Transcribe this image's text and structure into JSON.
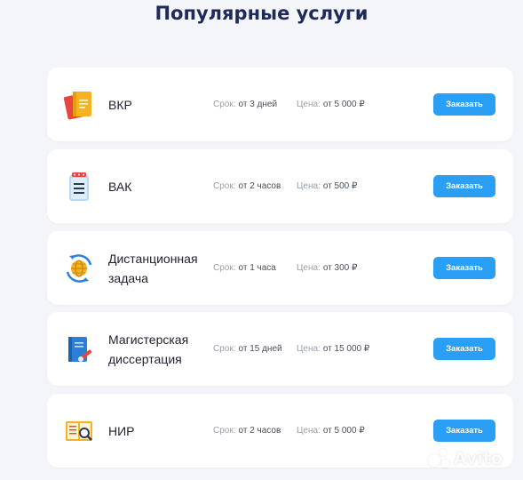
{
  "page": {
    "title": "Популярные услуги"
  },
  "services": [
    {
      "name": "ВКР",
      "term_label": "Срок:",
      "term_value": "от 3 дней",
      "price_label": "Цена:",
      "price_value": "от 5 000 ₽",
      "button": "Заказать",
      "icon": "notebook-icon"
    },
    {
      "name": "ВАК",
      "term_label": "Срок:",
      "term_value": "от 2 часов",
      "price_label": "Цена:",
      "price_value": "от 500 ₽",
      "button": "Заказать",
      "icon": "notepad-icon"
    },
    {
      "name": "Дистанционная задача",
      "term_label": "Срок:",
      "term_value": "от 1 часа",
      "price_label": "Цена:",
      "price_value": "от 300 ₽",
      "button": "Заказать",
      "icon": "globe-icon"
    },
    {
      "name": "Магистерская диссертация",
      "term_label": "Срок:",
      "term_value": "от 15 дней",
      "price_label": "Цена:",
      "price_value": "от 15 000 ₽",
      "button": "Заказать",
      "icon": "book-pen-icon"
    },
    {
      "name": "НИР",
      "term_label": "Срок:",
      "term_value": "от 2 часов",
      "price_label": "Цена:",
      "price_value": "от 5 000 ₽",
      "button": "Заказать",
      "icon": "open-book-magnifier-icon"
    }
  ],
  "watermark": {
    "text": "Avito"
  },
  "colors": {
    "accent": "#2b9ef5",
    "title": "#1e2a5a",
    "background": "#f4f5f8"
  }
}
